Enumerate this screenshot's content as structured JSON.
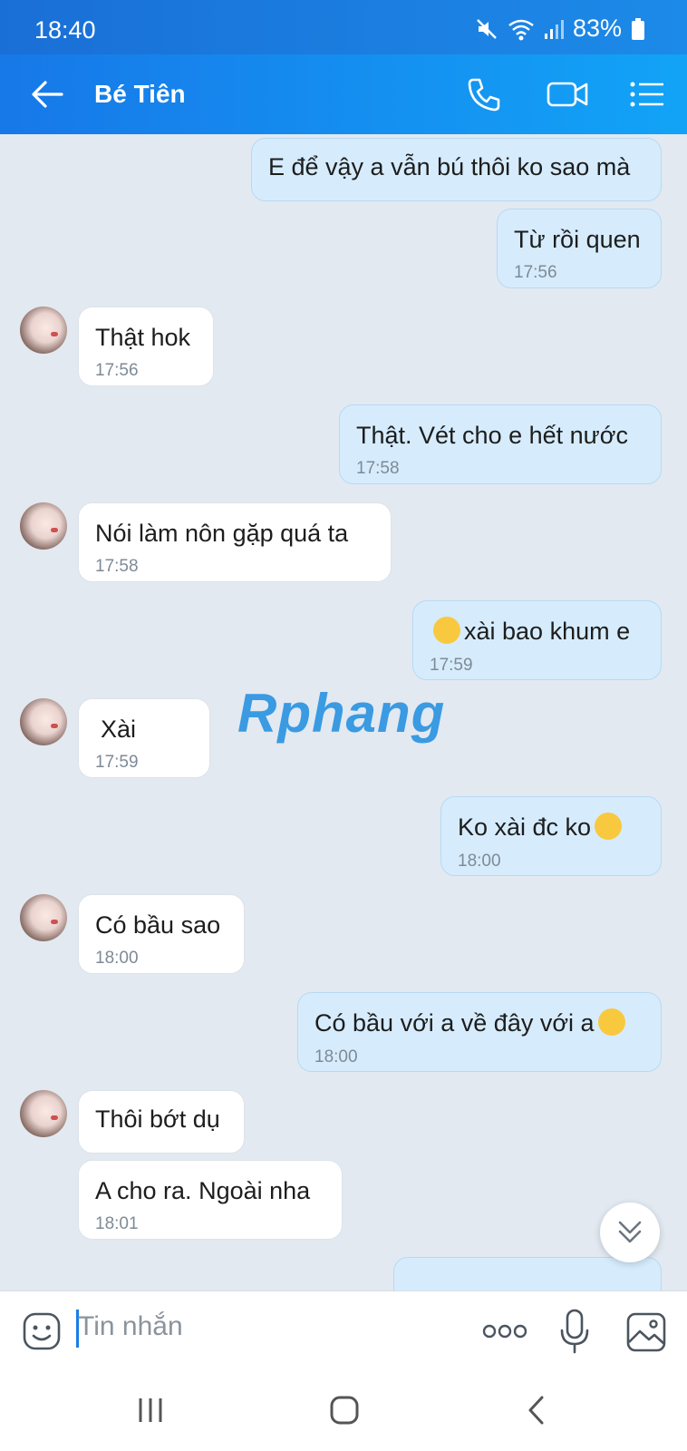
{
  "status": {
    "time": "18:40",
    "battery": "83%"
  },
  "header": {
    "title": "Bé Tiên"
  },
  "messages": [
    {
      "dir": "out",
      "text": "E để vậy a vẫn bú thôi ko sao mà",
      "time": ""
    },
    {
      "dir": "out",
      "text": "Từ rồi quen",
      "time": "17:56"
    },
    {
      "dir": "in",
      "text": "Thật hok",
      "time": "17:56"
    },
    {
      "dir": "out",
      "text": "Thật. Vét cho e hết nước",
      "time": "17:58"
    },
    {
      "dir": "in",
      "text": "Nói làm nôn gặp quá ta",
      "time": "17:58"
    },
    {
      "dir": "out",
      "text": "xài bao khum e",
      "time": "17:59"
    },
    {
      "dir": "in",
      "text": "Xài",
      "time": "17:59"
    },
    {
      "dir": "out",
      "text": "Ko xài đc ko",
      "time": "18:00"
    },
    {
      "dir": "in",
      "text": "Có bầu sao",
      "time": "18:00"
    },
    {
      "dir": "out",
      "text": "Có bầu với a về đây với a",
      "time": "18:00"
    },
    {
      "dir": "in",
      "text": "Thôi bớt dụ",
      "time": ""
    },
    {
      "dir": "in",
      "text": "A cho ra. Ngoài nha",
      "time": "18:01"
    }
  ],
  "watermark": {
    "text": "Rphang"
  },
  "input": {
    "placeholder": "Tin nhắn"
  },
  "icons": {
    "back": "arrow-left-icon",
    "call": "phone-icon",
    "video": "video-camera-icon",
    "menu": "list-menu-icon",
    "sticker": "sticker-smile-icon",
    "more": "more-dots-icon",
    "mic": "microphone-icon",
    "gallery": "image-gallery-icon",
    "scroll": "double-chevron-down-icon"
  },
  "colors": {
    "header": "#1778e8",
    "outgoing_bubble": "#d6ecfd",
    "incoming_bubble": "#ffffff",
    "background": "#e2e9f1"
  }
}
